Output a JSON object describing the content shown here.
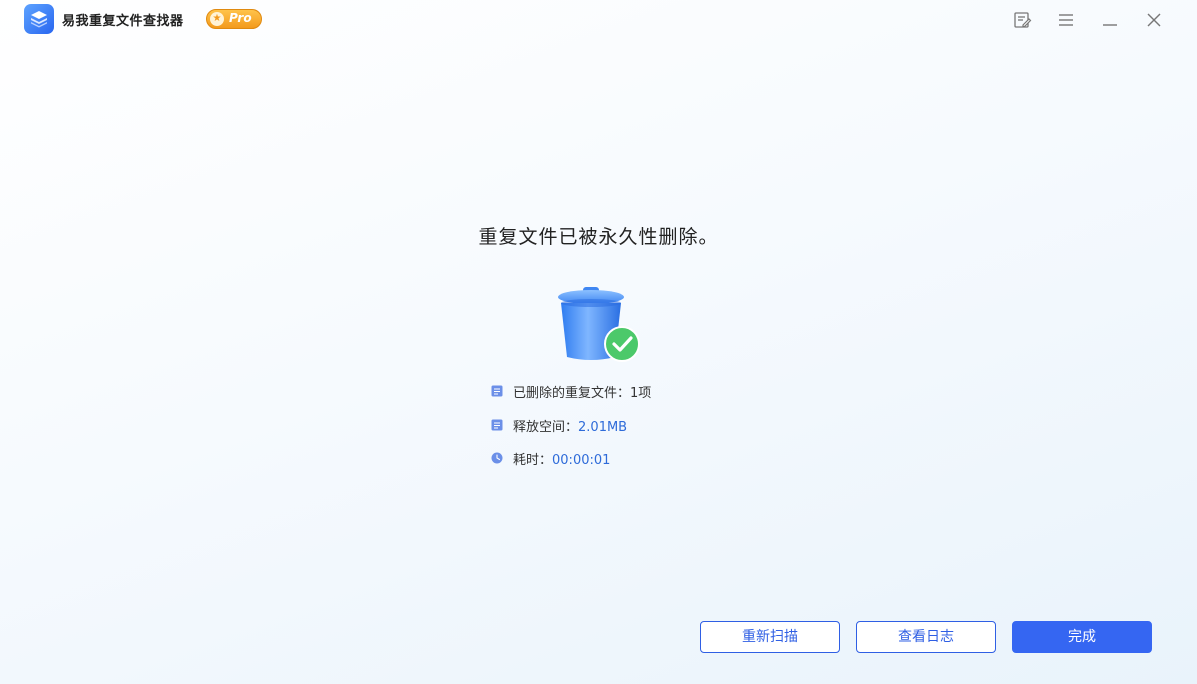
{
  "app": {
    "title": "易我重复文件查找器",
    "badge": "Pro",
    "icon": "app-logo-icon"
  },
  "window_controls": [
    {
      "name": "feedback",
      "icon": "feedback-icon"
    },
    {
      "name": "menu",
      "icon": "menu-icon"
    },
    {
      "name": "minimize",
      "icon": "minimize-icon"
    },
    {
      "name": "close",
      "icon": "close-icon"
    }
  ],
  "result": {
    "title": "重复文件已被永久性删除。",
    "illustration": "trash-bin-check-icon",
    "items": [
      {
        "label": "已删除的重复文件：",
        "value": "1项",
        "icon": "file-icon"
      },
      {
        "label": "释放空间：",
        "value": "2.01MB",
        "icon": "disk-icon"
      },
      {
        "label": "耗时：",
        "value": "00:00:01",
        "icon": "clock-icon"
      }
    ]
  },
  "buttons": {
    "rescan": "重新扫描",
    "view_log": "查看日志",
    "done": "完成"
  },
  "colors": {
    "accent": "#3566f2",
    "value_text": "#2e6bd9",
    "success": "#4cc96a",
    "badge": "#f39a1d"
  }
}
